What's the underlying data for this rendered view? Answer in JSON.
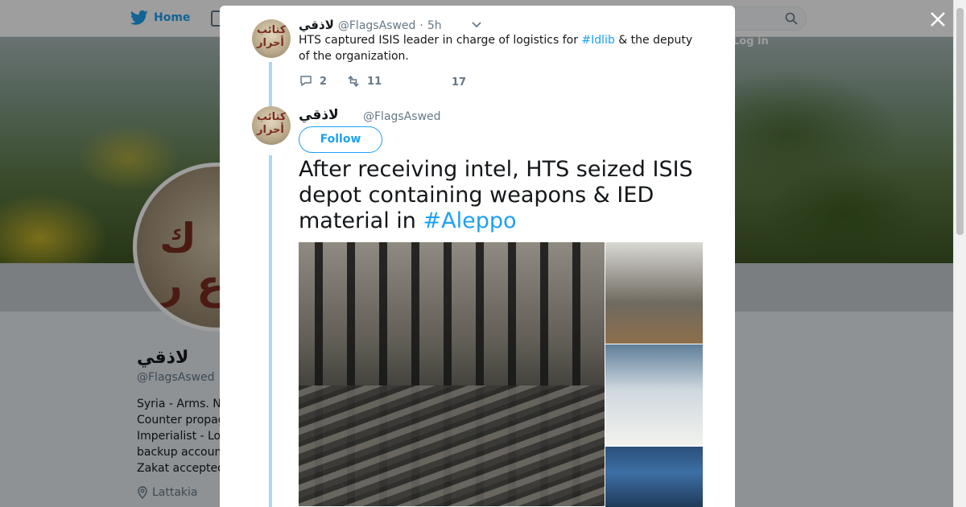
{
  "nav": {
    "home_label": "Home",
    "login_label": "Log in"
  },
  "profile": {
    "name": "لاذقي",
    "handle": "@FlagsAswed",
    "bio_lines": [
      "Syria - Arms. N",
      "Counter propag",
      "Imperialist - Lo",
      "backup accoun",
      "Zakat accepted"
    ],
    "location": "Lattakia"
  },
  "tweet1": {
    "name": "لاذقي",
    "handle": "@FlagsAswed",
    "dot": "·",
    "time": "5h",
    "text_before": "HTS captured ISIS leader in charge of logistics for ",
    "hashtag": "#Idlib",
    "text_after": " & the deputy of the organization.",
    "replies": "2",
    "retweets": "11",
    "likes": "17"
  },
  "tweet2": {
    "name": "لاذقي",
    "handle": "@FlagsAswed",
    "follow_label": "Follow",
    "text": "After receiving intel, HTS seized ISIS depot containing weapons & IED material in ",
    "hashtag": "#Aleppo"
  },
  "colors": {
    "accent": "#1da1f2",
    "thread": "#a8d8f5",
    "muted": "#657786"
  },
  "icons": [
    "twitter-bird-icon",
    "lightning-icon",
    "search-icon",
    "close-icon",
    "chevron-down-icon",
    "reply-icon",
    "retweet-icon",
    "location-pin-icon"
  ]
}
